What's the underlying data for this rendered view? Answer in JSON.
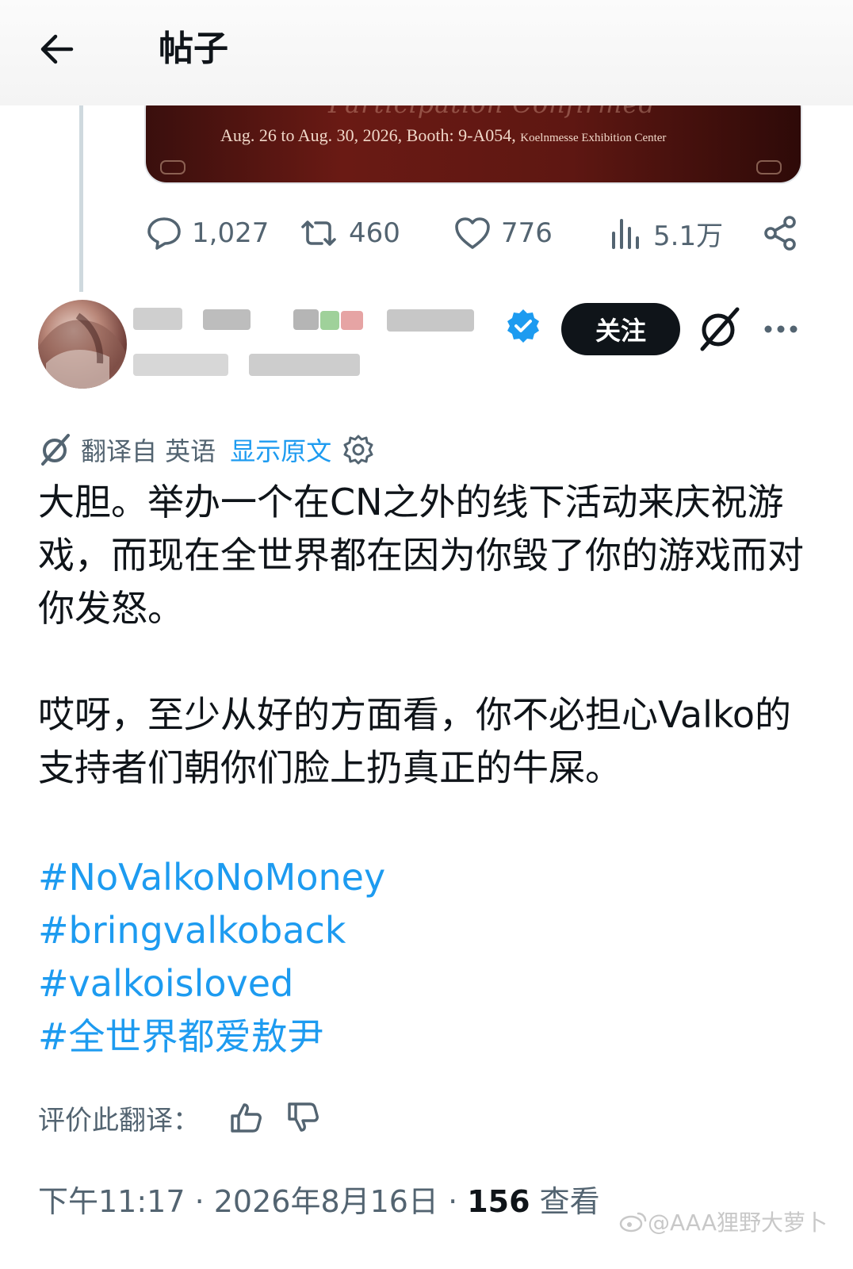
{
  "header": {
    "title": "帖子"
  },
  "media": {
    "ghost_title": "Participation Confirmed",
    "event_main": "Aug. 26 to Aug. 30, 2026, Booth: 9-A054,",
    "event_venue": "Koelnmesse Exhibition Center"
  },
  "actions": {
    "replies": "1,027",
    "reposts": "460",
    "likes": "776",
    "views": "5.1万"
  },
  "author": {
    "follow_label": "关注"
  },
  "translation": {
    "note": "翻译自 英语",
    "show_original": "显示原文"
  },
  "post": {
    "para1": "大胆。举办一个在CN之外的线下活动来庆祝游戏，而现在全世界都在因为你毁了你的游戏而对你发怒。",
    "para2": "哎呀，至少从好的方面看，你不必担心Valko的支持者们朝你们脸上扔真正的牛屎。",
    "hashtags": [
      "#NoValkoNoMoney",
      "#bringvalkoback",
      "#valkoisloved",
      "#全世界都爱敖尹"
    ]
  },
  "rate": {
    "label": "评价此翻译："
  },
  "meta": {
    "time": "下午11:17 · 2026年8月16日 · ",
    "views_count": "156",
    "views_label": " 查看"
  },
  "watermark": "@AAA狸野大萝卜"
}
